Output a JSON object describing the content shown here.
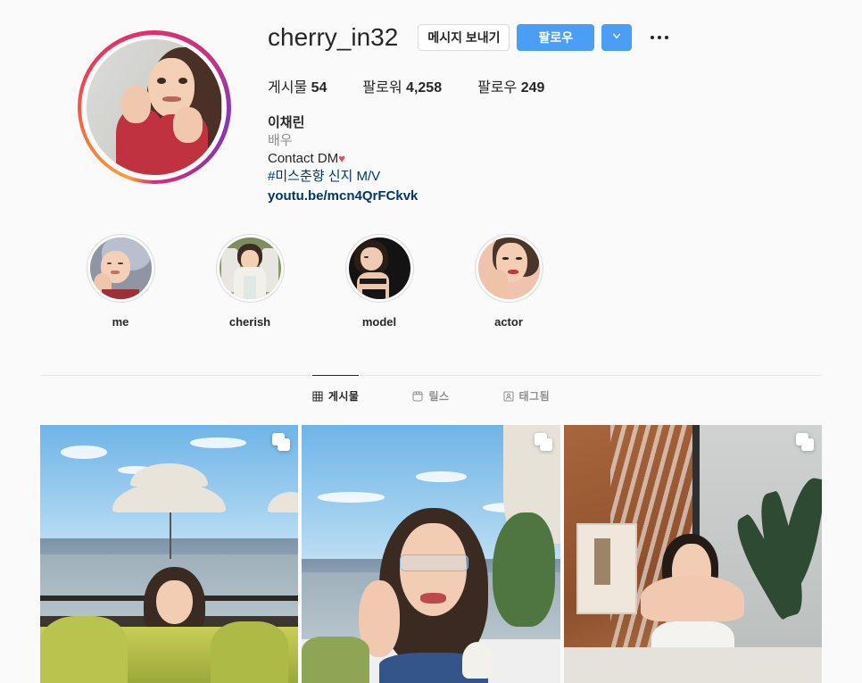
{
  "profile": {
    "username": "cherry_in32",
    "avatar_alt": "profile-photo",
    "has_story_ring": true,
    "buttons": {
      "message": "메시지 보내기",
      "follow": "팔로우",
      "dropdown_icon": "chevron-down-icon",
      "more_icon": "more-options-icon"
    },
    "stats": [
      {
        "label": "게시물",
        "value": "54",
        "name": "posts"
      },
      {
        "label": "팔로워",
        "value": "4,258",
        "name": "followers"
      },
      {
        "label": "팔로우",
        "value": "249",
        "name": "following"
      }
    ],
    "bio": {
      "full_name": "이채린",
      "category": "배우",
      "line1": "Contact DM",
      "line1_emoji": "♥",
      "hashtag_line": "#미스춘향 신지 M/V",
      "link": "youtu.be/mcn4QrFCkvk"
    }
  },
  "highlights": [
    {
      "label": "me"
    },
    {
      "label": "cherish"
    },
    {
      "label": "model"
    },
    {
      "label": "actor"
    }
  ],
  "tabs": [
    {
      "label": "게시물",
      "icon": "grid-icon",
      "active": true
    },
    {
      "label": "릴스",
      "icon": "reels-icon",
      "active": false
    },
    {
      "label": "태그됨",
      "icon": "tagged-icon",
      "active": false
    }
  ],
  "posts": [
    {
      "alt": "lakeside-umbrella-photo",
      "is_carousel": true
    },
    {
      "alt": "lakeside-glasses-photo",
      "is_carousel": true
    },
    {
      "alt": "indoor-interior-photo",
      "is_carousel": true
    }
  ],
  "colors": {
    "accent_blue": "#4a9ef5",
    "link_blue": "#00376b",
    "muted": "#8e8e8e",
    "background": "#fafafa",
    "text": "#262626",
    "heart_red": "#ed4956"
  }
}
